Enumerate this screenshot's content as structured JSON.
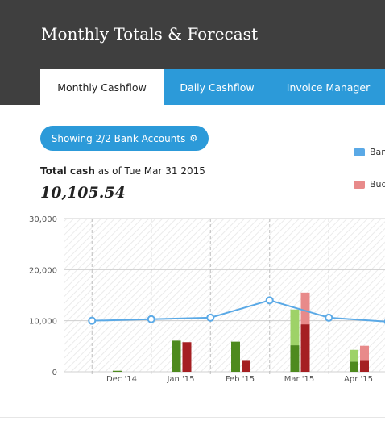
{
  "header": {
    "title": "Monthly Totals & Forecast"
  },
  "tabs": [
    {
      "label": "Monthly Cashflow",
      "active": true
    },
    {
      "label": "Daily Cashflow",
      "active": false
    },
    {
      "label": "Invoice Manager",
      "active": false
    }
  ],
  "accounts_button": {
    "label": "Showing 2/2 Bank Accounts",
    "icon": "gear-icon"
  },
  "legend": [
    {
      "label": "Ban",
      "color": "#5aa9e6"
    },
    {
      "label": "Bud",
      "color": "#e88a8a"
    }
  ],
  "summary": {
    "total_label": "Total cash",
    "as_of_text": "as of Tue Mar 31 2015",
    "total_value": "10,105.54"
  },
  "colors": {
    "accent": "#2c9ad9",
    "header_bg": "#3f3f3f",
    "income": "#4e8a1e",
    "income_forecast": "#9ed268",
    "expense": "#a51f22",
    "expense_forecast": "#e88a8a",
    "balance_line": "#5aa9e6"
  },
  "chart_data": {
    "type": "bar",
    "categories": [
      "Dec '14",
      "Jan '15",
      "Feb '15",
      "Mar '15",
      "Apr '15"
    ],
    "ylim": [
      0,
      30000
    ],
    "yticks": [
      0,
      10000,
      20000,
      30000
    ],
    "ytick_labels": [
      "0",
      "10,000",
      "20,000",
      "30,000"
    ],
    "grid": true,
    "income": [
      {
        "actual": 200,
        "forecast": 0
      },
      {
        "actual": 6100,
        "forecast": 0
      },
      {
        "actual": 5900,
        "forecast": 0
      },
      {
        "actual": 5200,
        "forecast": 7000
      },
      {
        "actual": 2000,
        "forecast": 2300
      }
    ],
    "expense": [
      {
        "actual": 0,
        "forecast": 0
      },
      {
        "actual": 5800,
        "forecast": 0
      },
      {
        "actual": 2300,
        "forecast": 0
      },
      {
        "actual": 9300,
        "forecast": 6200
      },
      {
        "actual": 2300,
        "forecast": 2800
      }
    ],
    "balance": {
      "x": [
        -0.5,
        0.5,
        1.5,
        2.5,
        3.5,
        4.5
      ],
      "y": [
        10000,
        10300,
        10600,
        14000,
        10600,
        9800
      ]
    }
  }
}
